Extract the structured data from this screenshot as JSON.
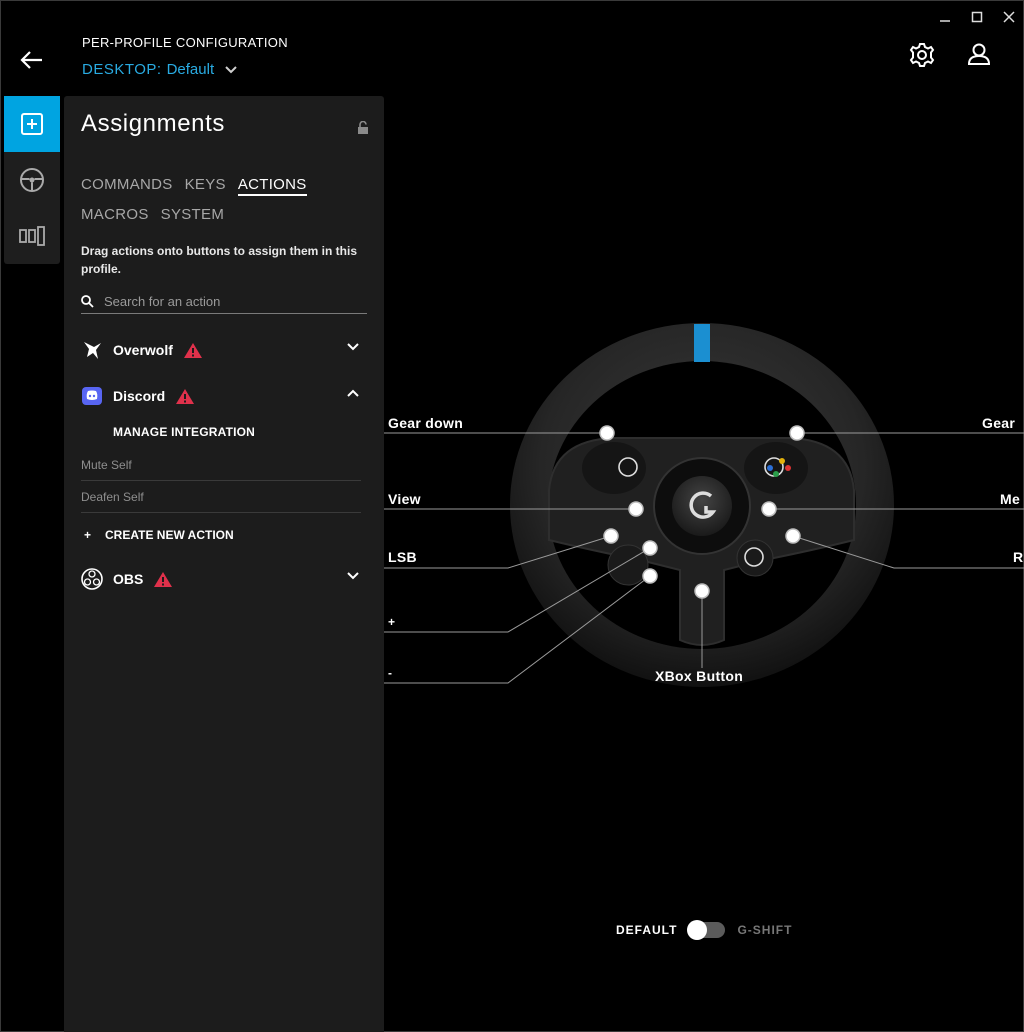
{
  "window": {
    "minimize": "–",
    "maximize": "□",
    "close": "✕"
  },
  "header": {
    "title": "PER-PROFILE CONFIGURATION",
    "profile_label": "DESKTOP:",
    "profile_value": "Default"
  },
  "icons": {
    "back": "arrow-left-icon",
    "settings": "gear-icon",
    "account": "user-icon",
    "rail": [
      "plus-square-icon",
      "steering-wheel-icon",
      "bars-icon"
    ],
    "lock": "unlock-icon",
    "search": "search-icon",
    "warning": "warning-triangle-icon"
  },
  "colors": {
    "accent": "#00a4e1",
    "link": "#29abe2",
    "warning": "#e0314b"
  },
  "panel": {
    "title": "Assignments",
    "tabs": [
      "COMMANDS",
      "KEYS",
      "ACTIONS",
      "MACROS",
      "SYSTEM"
    ],
    "active_tab": "ACTIONS",
    "description": "Drag actions onto buttons to assign them in this profile.",
    "search_placeholder": "Search for an action",
    "groups": [
      {
        "name": "Overwolf",
        "expanded": false,
        "warning": true
      },
      {
        "name": "Discord",
        "expanded": true,
        "warning": true
      },
      {
        "name": "OBS",
        "expanded": false,
        "warning": true
      }
    ],
    "discord_manage": "MANAGE INTEGRATION",
    "discord_actions": [
      "Mute Self",
      "Deafen Self"
    ],
    "create_action": "CREATE NEW ACTION",
    "create_symbol": "+"
  },
  "wheel": {
    "callouts": {
      "gear_down": "Gear down",
      "gear_up_partial": "Gear",
      "view": "View",
      "menu_partial": "Me",
      "lsb": "LSB",
      "rsb_partial": "R",
      "plus": "+",
      "minus": "-",
      "xbox": "XBox Button"
    }
  },
  "mode_toggle": {
    "left": "DEFAULT",
    "right": "G-SHIFT",
    "state": "DEFAULT"
  }
}
